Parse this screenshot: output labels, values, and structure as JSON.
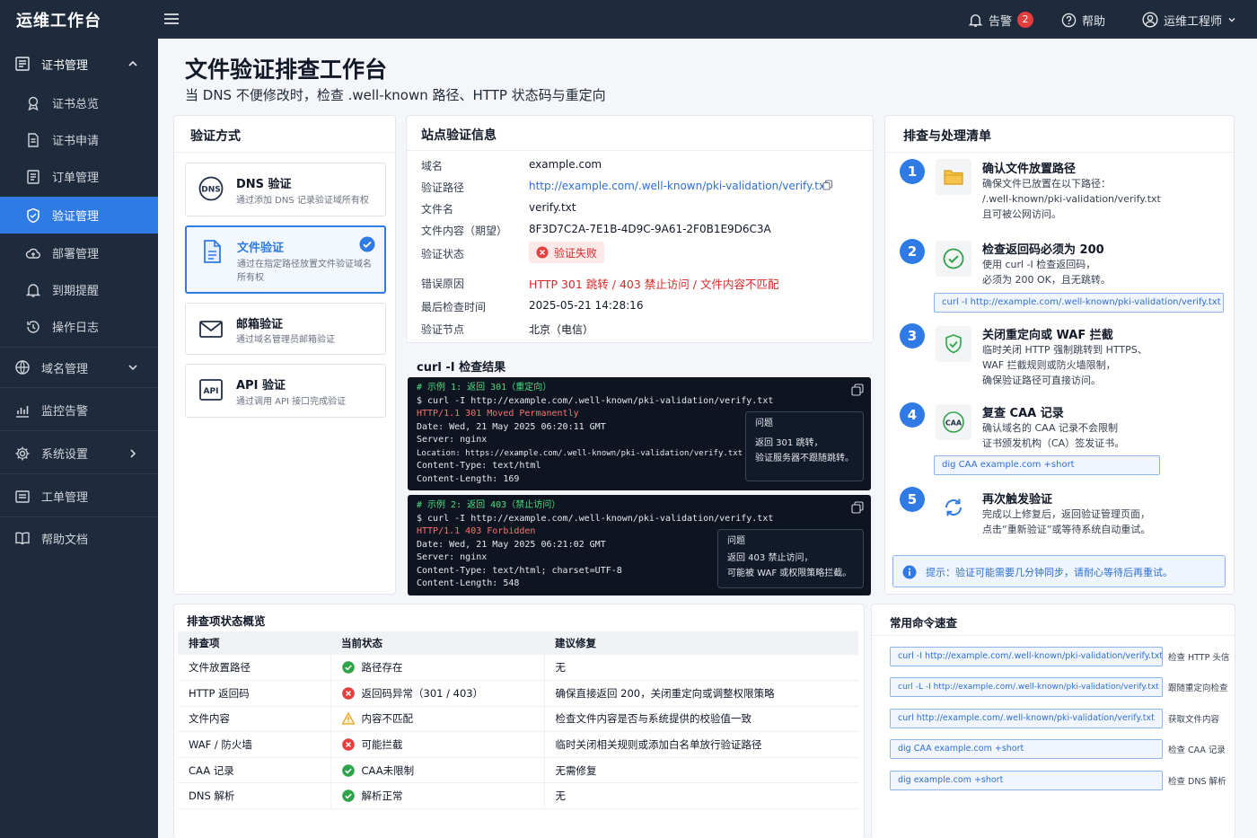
{
  "topbar": {
    "brand": "运维工作台",
    "alerts_label": "告警",
    "alerts_count": "2",
    "help_label": "帮助",
    "user_label": "运维工程师"
  },
  "sidebar": {
    "cert_group": "证书管理",
    "cert_items": [
      "证书总览",
      "证书申请",
      "订单管理",
      "验证管理",
      "部署管理",
      "到期提醒",
      "操作日志"
    ],
    "domain": "域名管理",
    "monitor": "监控告警",
    "settings": "系统设置",
    "tickets": "工单管理",
    "docs": "帮助文档"
  },
  "page": {
    "title": "文件验证排查工作台",
    "subtitle": "当 DNS 不便修改时，检查 .well-known 路径、HTTP 状态码与重定向"
  },
  "methods": {
    "title": "验证方式",
    "dns": {
      "icon_text": "DNS",
      "title": "DNS 验证",
      "desc": "通过添加 DNS 记录验证域所有权"
    },
    "file": {
      "title": "文件验证",
      "desc": "通过在指定路径放置文件验证域名所有权"
    },
    "email": {
      "title": "邮箱验证",
      "desc": "通过域名管理员邮箱验证"
    },
    "api": {
      "icon_text": "API",
      "title": "API 验证",
      "desc": "通过调用 API 接口完成验证"
    }
  },
  "site": {
    "title": "站点验证信息",
    "rows": [
      {
        "k": "域名",
        "v": "example.com"
      },
      {
        "k": "验证路径",
        "v": "http://example.com/.well-known/pki-validation/verify.txt"
      },
      {
        "k": "文件名",
        "v": "verify.txt"
      },
      {
        "k": "文件内容（期望）",
        "v": "8F3D7C2A-7E1B-4D9C-9A61-2F0B1E9D6C3A"
      },
      {
        "k": "验证状态",
        "v": "验证失败"
      },
      {
        "k": "错误原因",
        "v": "HTTP 301 跳转 / 403 禁止访问 / 文件内容不匹配"
      },
      {
        "k": "最后检查时间",
        "v": "2025-05-21 14:28:16"
      },
      {
        "k": "验证节点",
        "v": "北京（电信）"
      }
    ]
  },
  "curl": {
    "title": "curl -I 检查结果",
    "ex1": {
      "comment": "# 示例 1: 返回 301（重定向）",
      "cmd": "$ curl -I http://example.com/.well-known/pki-validation/verify.txt",
      "status": "HTTP/1.1 301 Moved Permanently",
      "lines": [
        "Date: Wed, 21 May 2025 06:20:11 GMT",
        "Server: nginx",
        "Location: https://example.com/.well-known/pki-validation/verify.txt",
        "Content-Type: text/html",
        "Content-Length: 169"
      ],
      "note_title": "问题",
      "note_lines": [
        "返回 301 跳转，",
        "验证服务器不跟随跳转。"
      ]
    },
    "ex2": {
      "comment": "# 示例 2: 返回 403（禁止访问）",
      "cmd": "$ curl -I http://example.com/.well-known/pki-validation/verify.txt",
      "status": "HTTP/1.1 403 Forbidden",
      "lines": [
        "Date: Wed, 21 May 2025 06:21:02 GMT",
        "Server: nginx",
        "Content-Type: text/html; charset=UTF-8",
        "Content-Length: 548"
      ],
      "note_title": "问题",
      "note_lines": [
        "返回 403 禁止访问，",
        "可能被 WAF 或权限策略拦截。"
      ]
    }
  },
  "checklist": {
    "title": "排查与处理清单",
    "steps": [
      {
        "num": "1",
        "title": "确认文件放置路径",
        "lines": [
          "确保文件已放置在以下路径：",
          "/.well-known/pki-validation/verify.txt",
          "且可被公网访问。"
        ]
      },
      {
        "num": "2",
        "title": "检查返回码必须为 200",
        "lines": [
          "使用 curl -I 检查返回码，",
          "必须为 200 OK，且无跳转。"
        ],
        "code": "curl  -I  http://example.com/.well-known/pki-validation/verify.txt"
      },
      {
        "num": "3",
        "title": "关闭重定向或 WAF 拦截",
        "lines": [
          "临时关闭 HTTP 强制跳转到 HTTPS、",
          "WAF 拦截规则或防火墙限制，",
          "确保验证路径可直接访问。"
        ]
      },
      {
        "num": "4",
        "title": "复查 CAA 记录",
        "icon_text": "CAA",
        "lines": [
          "确认域名的 CAA 记录不会限制",
          "证书颁发机构（CA）签发证书。"
        ],
        "code": "dig  CAA  example.com  +short"
      },
      {
        "num": "5",
        "title": "再次触发验证",
        "lines": [
          "完成以上修复后，返回验证管理页面，",
          "点击“重新验证”或等待系统自动重试。"
        ]
      }
    ],
    "tip": "提示：验证可能需要几分钟同步，请耐心等待后再重试。"
  },
  "status_table": {
    "title": "排查项状态概览",
    "headers": [
      "排查项",
      "当前状态",
      "建议修复"
    ],
    "rows": [
      {
        "item": "文件放置路径",
        "status": "路径存在",
        "state": "ok",
        "fix": "无"
      },
      {
        "item": "HTTP 返回码",
        "status": "返回码异常（301 / 403）",
        "state": "error",
        "fix": "确保直接返回 200，关闭重定向或调整权限策略"
      },
      {
        "item": "文件内容",
        "status": "内容不匹配",
        "state": "warn",
        "fix": "检查文件内容是否与系统提供的校验值一致"
      },
      {
        "item": "WAF / 防火墙",
        "status": "可能拦截",
        "state": "error",
        "fix": "临时关闭相关规则或添加白名单放行验证路径"
      },
      {
        "item": "CAA 记录",
        "status": "CAA未限制",
        "state": "ok",
        "fix": "无需修复"
      },
      {
        "item": "DNS 解析",
        "status": "解析正常",
        "state": "ok",
        "fix": "无"
      }
    ]
  },
  "quick": {
    "title": "常用命令速查",
    "items": [
      {
        "cmd": "curl  -I  http://example.com/.well-known/pki-validation/verify.txt",
        "label": "检查 HTTP 头信"
      },
      {
        "cmd": "curl  -L  -I  http://example.com/.well-known/pki-validation/verify.txt",
        "label": "跟随重定向检查"
      },
      {
        "cmd": "curl  http://example.com/.well-known/pki-validation/verify.txt",
        "label": "获取文件内容"
      },
      {
        "cmd": "dig  CAA  example.com  +short",
        "label": "检查 CAA 记录"
      },
      {
        "cmd": "dig  example.com  +short",
        "label": "检查 DNS 解析"
      }
    ]
  },
  "colors": {
    "accent": "#2f7ae5",
    "sidebar": "#1e2b3c",
    "error": "#e53e3e",
    "success": "#2fa34a",
    "warning": "#f0a020"
  }
}
